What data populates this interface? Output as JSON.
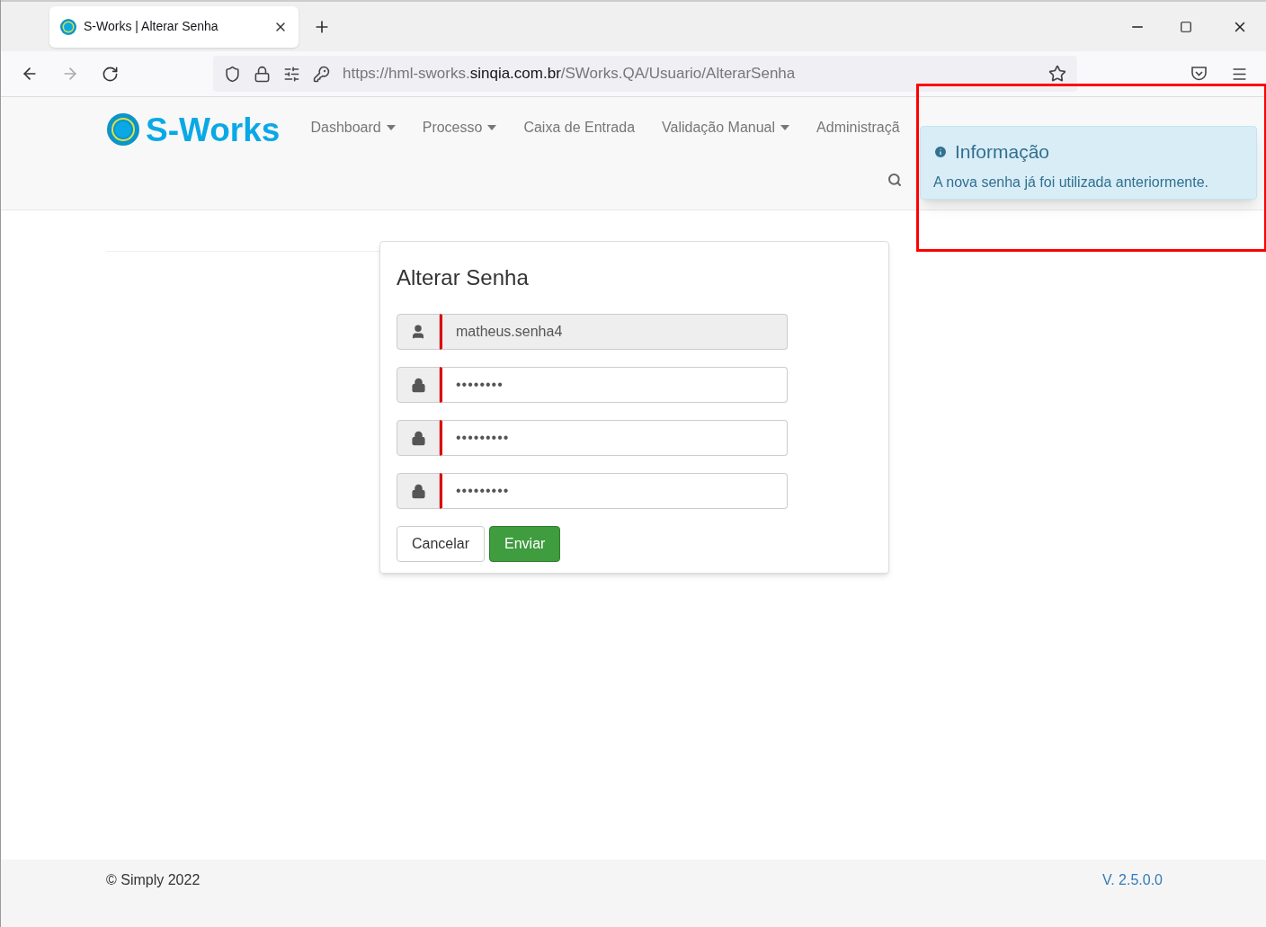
{
  "browser": {
    "tab": {
      "title": "S-Works | Alterar Senha",
      "selected": true
    },
    "url": {
      "prefix": "https://hml-sworks.",
      "domain": "sinqia.com.br",
      "path": "/SWorks.QA/Usuario/AlterarSenha"
    }
  },
  "navbar": {
    "brand": "S-Works",
    "items": [
      {
        "label": "Dashboard",
        "dropdown": true
      },
      {
        "label": "Processo",
        "dropdown": true
      },
      {
        "label": "Caixa de Entrada",
        "dropdown": false
      },
      {
        "label": "Validação Manual",
        "dropdown": true
      },
      {
        "label": "Administraçã",
        "dropdown": false
      }
    ]
  },
  "form": {
    "title": "Alterar Senha",
    "fields": [
      {
        "kind": "user",
        "value": "matheus.senha4",
        "disabled": true
      },
      {
        "kind": "password",
        "value": "••••••••",
        "disabled": false
      },
      {
        "kind": "password",
        "value": "•••••••••",
        "disabled": false
      },
      {
        "kind": "password",
        "value": "•••••••••",
        "disabled": false
      }
    ],
    "buttons": [
      {
        "label": "Cancelar",
        "kind": "default"
      },
      {
        "label": "Enviar",
        "kind": "primary"
      }
    ]
  },
  "toast": {
    "title": "Informação",
    "message": "A nova senha já foi utilizada anteriormente."
  },
  "footer": {
    "copyright": "© Simply 2022",
    "version": "V. 2.5.0.0"
  }
}
